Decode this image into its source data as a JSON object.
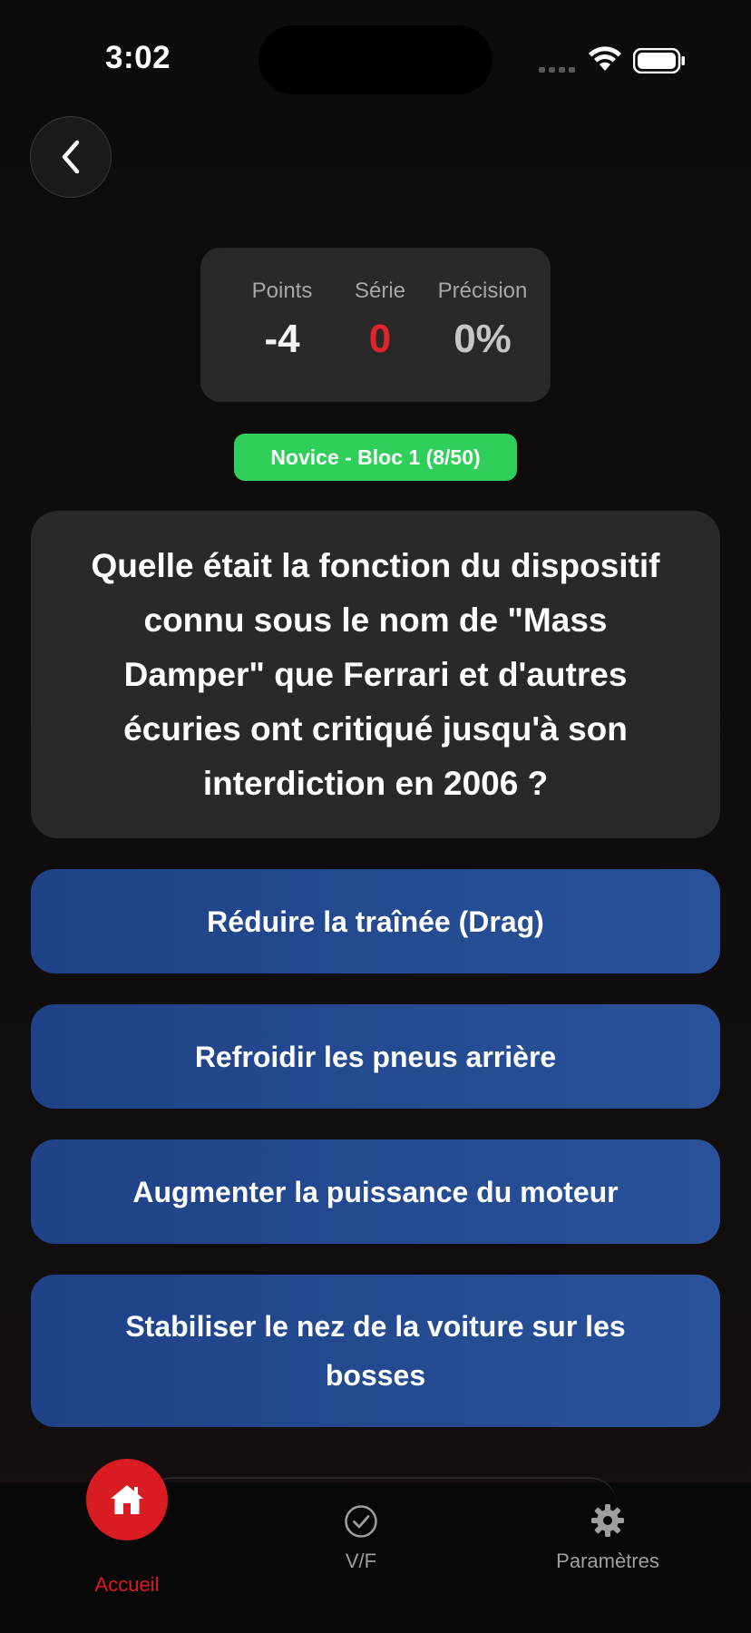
{
  "status_bar": {
    "time": "3:02"
  },
  "stats": {
    "points_label": "Points",
    "points_value": "-4",
    "serie_label": "Série",
    "serie_value": "0",
    "precision_label": "Précision",
    "precision_value": "0%"
  },
  "level_badge": "Novice - Bloc 1 (8/50)",
  "question": "Quelle était la fonction du dispositif connu sous le nom de \"Mass Damper\" que Ferrari et d'autres écuries ont critiqué jusqu'à son interdiction en 2006 ?",
  "answers": [
    "Réduire la traînée (Drag)",
    "Refroidir les pneus arrière",
    "Augmenter la puissance du moteur",
    "Stabiliser le nez de la voiture sur les bosses"
  ],
  "tabs": {
    "home": "Accueil",
    "vf": "V/F",
    "settings": "Paramètres"
  },
  "colors": {
    "accent_red": "#d91c22",
    "badge_green": "#2fcf5a",
    "answer_blue": "#24499a",
    "serie_red": "#e0242a",
    "precision_gray": "#c8c6c6"
  },
  "icons": {
    "back": "chevron-left-icon",
    "home": "house-icon",
    "vf": "check-circle-icon",
    "settings": "gear-icon"
  }
}
